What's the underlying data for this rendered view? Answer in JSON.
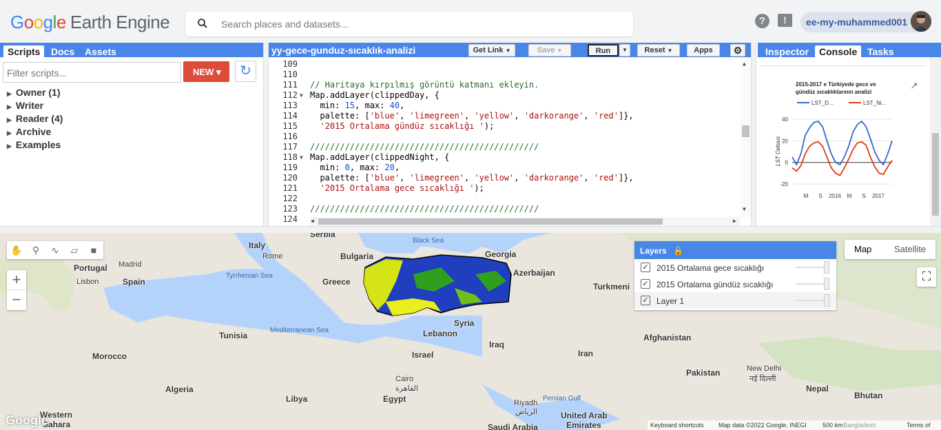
{
  "header": {
    "logo_google": "Google",
    "logo_product": "Earth Engine",
    "search_placeholder": "Search places and datasets...",
    "help_symbol": "?",
    "feedback_symbol": "!",
    "username": "ee-my-muhammed001"
  },
  "left_tabs": [
    "Scripts",
    "Docs",
    "Assets"
  ],
  "left_panel": {
    "filter_placeholder": "Filter scripts...",
    "new_label": "NEW ▾",
    "folders": [
      "Owner (1)",
      "Writer",
      "Reader (4)",
      "Archive",
      "Examples"
    ]
  },
  "editor": {
    "title": "yy-gece-gunduz-sıcaklık-analizi",
    "buttons": {
      "get_link": "Get Link",
      "save": "Save",
      "run": "Run",
      "reset": "Reset",
      "apps": "Apps"
    },
    "line_numbers": [
      "109",
      "110",
      "111",
      "112",
      "113",
      "114",
      "115",
      "116",
      "117",
      "118",
      "119",
      "120",
      "121",
      "122",
      "123",
      "124"
    ]
  },
  "right_tabs": [
    "Inspector",
    "Console",
    "Tasks"
  ],
  "chart_data": {
    "type": "line",
    "title": "2015-2017 e Türkiyede gece ve gündüz sıcaklıklarının analizi",
    "ylabel": "LST Celsius",
    "xlabel": "",
    "x_ticks": [
      "M",
      "S",
      "2016",
      "M",
      "S",
      "2017"
    ],
    "y_ticks": [
      "40",
      "20",
      "0",
      "-20"
    ],
    "ylim": [
      -25,
      45
    ],
    "series": [
      {
        "name": "LST_D...",
        "color": "#3366cc",
        "values": [
          5,
          -2,
          8,
          25,
          32,
          37,
          38,
          33,
          20,
          8,
          0,
          -2,
          5,
          15,
          28,
          35,
          38,
          33,
          22,
          10,
          2,
          -2,
          8,
          20
        ]
      },
      {
        "name": "LST_Ni...",
        "color": "#dc3912",
        "values": [
          -5,
          -8,
          -3,
          8,
          15,
          18,
          19,
          15,
          5,
          -5,
          -10,
          -12,
          -5,
          3,
          12,
          18,
          19,
          16,
          5,
          -4,
          -10,
          -11,
          -4,
          2
        ]
      }
    ]
  },
  "map": {
    "layers_title": "Layers",
    "layers": [
      "2015 Ortalama gece sıcaklığı",
      "2015 Ortalama gündüz sıcaklığı",
      "Layer 1"
    ],
    "map_type": [
      "Map",
      "Satellite"
    ],
    "zoom_in": "+",
    "zoom_out": "−",
    "places": [
      "Serbia",
      "Italy",
      "Rome",
      "Portugal",
      "Madrid",
      "Spain",
      "Lisbon",
      "Bulgaria",
      "Greece",
      "Georgia",
      "Azerbaijan",
      "Turkmeni",
      "Syria",
      "Lebanon",
      "Iraq",
      "Israel",
      "Cairo",
      "القاهرة",
      "Egypt",
      "Libya",
      "Tunisia",
      "Morocco",
      "Algeria",
      "Afghanistan",
      "Iran",
      "Pakistan",
      "New Delhi",
      "नई दिल्ली",
      "Nepal",
      "Bhutan",
      "Riyadh",
      "الرياض",
      "United Arab",
      "Emirates",
      "Saudi Arabia",
      "Western",
      "Sahara"
    ],
    "seas": [
      "Black Sea",
      "Tyrrhenian Sea",
      "Mediterranean Sea",
      "Persian Gulf"
    ],
    "attribution": {
      "keyboard": "Keyboard shortcuts",
      "data": "Map data ©2022 Google, INEGI",
      "scale": "500 km",
      "terms": "Terms of Use",
      "bangladesh": "Bangladesh"
    },
    "google": "Google"
  }
}
